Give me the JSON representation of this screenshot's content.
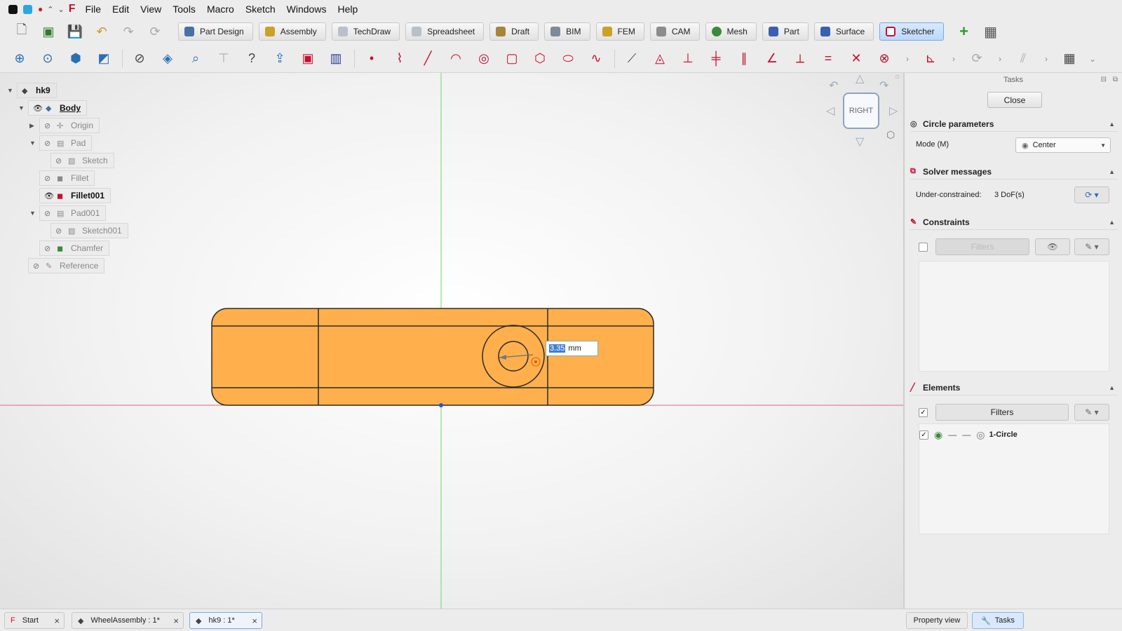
{
  "menubar": {
    "items": [
      "File",
      "Edit",
      "View",
      "Tools",
      "Macro",
      "Sketch",
      "Windows",
      "Help"
    ]
  },
  "workbenches": [
    {
      "label": "Part Design",
      "color": "#4a6fa5"
    },
    {
      "label": "Assembly",
      "color": "#c9a227"
    },
    {
      "label": "TechDraw",
      "color": "#9aa3ad"
    },
    {
      "label": "Spreadsheet",
      "color": "#9aa3ad"
    },
    {
      "label": "Draft",
      "color": "#a8843a"
    },
    {
      "label": "BIM",
      "color": "#7d8a99"
    },
    {
      "label": "FEM",
      "color": "#c9a227"
    },
    {
      "label": "CAM",
      "color": "#8c8c8c"
    },
    {
      "label": "Mesh",
      "color": "#3b8a3b"
    },
    {
      "label": "Part",
      "color": "#3b5fb0"
    },
    {
      "label": "Surface",
      "color": "#3b5fb0"
    },
    {
      "label": "Sketcher",
      "color": "#c8102e",
      "active": true
    }
  ],
  "tree": {
    "root": "hk9",
    "items": [
      "Body",
      "Origin",
      "Pad",
      "Sketch",
      "Fillet",
      "Fillet001",
      "Pad001",
      "Sketch001",
      "Chamfer",
      "Reference"
    ]
  },
  "navcube": {
    "face": "RIGHT"
  },
  "dimension_input": {
    "value": "3.35",
    "unit": "mm"
  },
  "taskpanel": {
    "title": "Tasks",
    "close_label": "Close",
    "circle_parameters": {
      "heading": "Circle parameters",
      "mode_label": "Mode (M)",
      "mode_value": "Center"
    },
    "solver": {
      "heading": "Solver messages",
      "status_label": "Under-constrained:",
      "status_value": "3 DoF(s)"
    },
    "constraints": {
      "heading": "Constraints",
      "filter_label": "Filters"
    },
    "elements": {
      "heading": "Elements",
      "filter_label": "Filters",
      "items": [
        {
          "label": "1-Circle"
        }
      ]
    }
  },
  "doc_tabs": [
    "Start",
    "WheelAssembly : 1*",
    "hk9 : 1*"
  ],
  "panel_tabs": [
    "Property view",
    "Tasks"
  ],
  "colors": {
    "part_fill": "#ffb04c",
    "part_stroke": "#2b2b2b",
    "axis_vertical": "#66dd66",
    "axis_horizontal": "#d86a86",
    "accent_red": "#c8102e"
  }
}
